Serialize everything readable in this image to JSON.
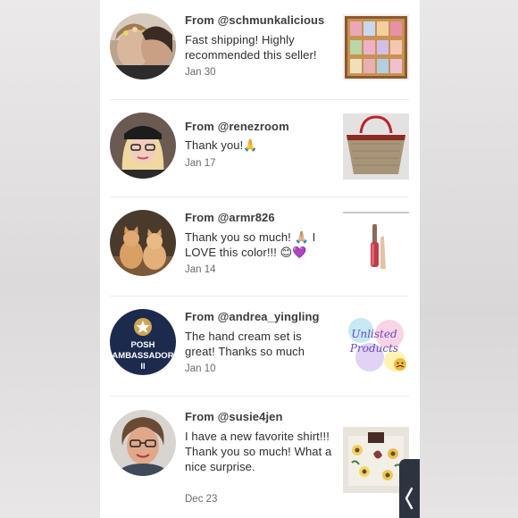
{
  "reviews": [
    {
      "from": "From @schmunkalicious",
      "message": "Fast shipping! Highly recommended this seller!",
      "date": "Jan 30",
      "avatar_icon": "couple-photo-avatar",
      "thumb_icon": "perfume-gift-box-thumbnail"
    },
    {
      "from": "From @renezroom",
      "message": "Thank you!🙏",
      "date": "Jan 17",
      "avatar_icon": "woman-with-cap-avatar",
      "thumb_icon": "tote-bag-thumbnail"
    },
    {
      "from": "From @armr826",
      "message": "Thank you so much! 🙏🏼 I LOVE this color!!! 😊💜",
      "date": "Jan 14",
      "avatar_icon": "two-cats-avatar",
      "thumb_icon": "lip-gloss-thumbnail"
    },
    {
      "from": "From @andrea_yingling",
      "message": "The hand cream set is great! Thanks so much",
      "date": "Jan 10",
      "avatar_text": "POSH AMBASSADOR II",
      "thumb_text": "Unlisted Products",
      "thumb_icon": "unlisted-products-thumbnail"
    },
    {
      "from": "From @susie4jen",
      "message": "I have a new favorite shirt!!! Thank you so much! What a nice surprise.",
      "date": "Dec 23",
      "avatar_icon": "woman-with-glasses-avatar",
      "thumb_icon": "floral-shirt-thumbnail"
    }
  ],
  "colors": {
    "ambassador_bg": "#1c2a4e",
    "drawer": "#2d3440"
  }
}
